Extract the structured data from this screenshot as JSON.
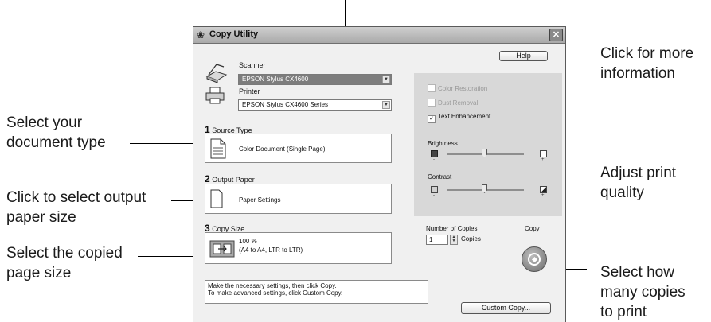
{
  "callouts": {
    "help": "Click for more\ninformation",
    "quality": "Adjust print\nquality",
    "copies": "Select how\nmany copies\nto print",
    "doc_type": "Select your\ndocument type",
    "output_paper": "Click to select output\npaper size",
    "copy_size": "Select the copied\npage size"
  },
  "window": {
    "title": "Copy Utility",
    "close_glyph": "✕",
    "help_label": "Help",
    "scanner_label": "Scanner",
    "scanner_value": "EPSON Stylus CX4600",
    "printer_label": "Printer",
    "printer_value": "EPSON Stylus CX4600 Series",
    "source_type": {
      "num": "1",
      "label": "Source Type",
      "value": "Color Document (Single Page)"
    },
    "output_paper": {
      "num": "2",
      "label": "Output Paper",
      "value": "Paper Settings"
    },
    "copy_size": {
      "num": "3",
      "label": "Copy Size",
      "line1": "100 %",
      "line2": "(A4 to A4, LTR to LTR)"
    },
    "options": {
      "color_restoration": {
        "label": "Color Restoration",
        "checked": false,
        "enabled": false
      },
      "dust_removal": {
        "label": "Dust Removal",
        "checked": false,
        "enabled": false
      },
      "text_enhancement": {
        "label": "Text Enhancement",
        "checked": true,
        "enabled": true
      }
    },
    "brightness_label": "Brightness",
    "contrast_label": "Contrast",
    "slider_minus": "-",
    "slider_plus": "+",
    "copies_label": "Number of Copies",
    "copies_value": "1",
    "copies_unit": "Copies",
    "copy_label": "Copy",
    "message_line1": "Make the necessary settings, then click Copy.",
    "message_line2": "To make advanced settings, click Custom Copy.",
    "custom_copy_label": "Custom Copy..."
  }
}
